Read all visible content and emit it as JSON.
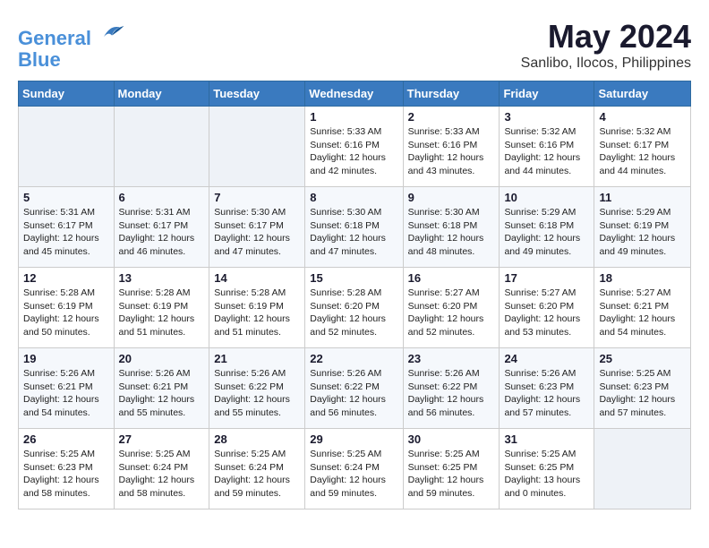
{
  "header": {
    "logo_line1": "General",
    "logo_line2": "Blue",
    "month": "May 2024",
    "location": "Sanlibo, Ilocos, Philippines"
  },
  "weekdays": [
    "Sunday",
    "Monday",
    "Tuesday",
    "Wednesday",
    "Thursday",
    "Friday",
    "Saturday"
  ],
  "weeks": [
    [
      {
        "day": "",
        "sunrise": "",
        "sunset": "",
        "daylight": ""
      },
      {
        "day": "",
        "sunrise": "",
        "sunset": "",
        "daylight": ""
      },
      {
        "day": "",
        "sunrise": "",
        "sunset": "",
        "daylight": ""
      },
      {
        "day": "1",
        "sunrise": "Sunrise: 5:33 AM",
        "sunset": "Sunset: 6:16 PM",
        "daylight": "Daylight: 12 hours and 42 minutes."
      },
      {
        "day": "2",
        "sunrise": "Sunrise: 5:33 AM",
        "sunset": "Sunset: 6:16 PM",
        "daylight": "Daylight: 12 hours and 43 minutes."
      },
      {
        "day": "3",
        "sunrise": "Sunrise: 5:32 AM",
        "sunset": "Sunset: 6:16 PM",
        "daylight": "Daylight: 12 hours and 44 minutes."
      },
      {
        "day": "4",
        "sunrise": "Sunrise: 5:32 AM",
        "sunset": "Sunset: 6:17 PM",
        "daylight": "Daylight: 12 hours and 44 minutes."
      }
    ],
    [
      {
        "day": "5",
        "sunrise": "Sunrise: 5:31 AM",
        "sunset": "Sunset: 6:17 PM",
        "daylight": "Daylight: 12 hours and 45 minutes."
      },
      {
        "day": "6",
        "sunrise": "Sunrise: 5:31 AM",
        "sunset": "Sunset: 6:17 PM",
        "daylight": "Daylight: 12 hours and 46 minutes."
      },
      {
        "day": "7",
        "sunrise": "Sunrise: 5:30 AM",
        "sunset": "Sunset: 6:17 PM",
        "daylight": "Daylight: 12 hours and 47 minutes."
      },
      {
        "day": "8",
        "sunrise": "Sunrise: 5:30 AM",
        "sunset": "Sunset: 6:18 PM",
        "daylight": "Daylight: 12 hours and 47 minutes."
      },
      {
        "day": "9",
        "sunrise": "Sunrise: 5:30 AM",
        "sunset": "Sunset: 6:18 PM",
        "daylight": "Daylight: 12 hours and 48 minutes."
      },
      {
        "day": "10",
        "sunrise": "Sunrise: 5:29 AM",
        "sunset": "Sunset: 6:18 PM",
        "daylight": "Daylight: 12 hours and 49 minutes."
      },
      {
        "day": "11",
        "sunrise": "Sunrise: 5:29 AM",
        "sunset": "Sunset: 6:19 PM",
        "daylight": "Daylight: 12 hours and 49 minutes."
      }
    ],
    [
      {
        "day": "12",
        "sunrise": "Sunrise: 5:28 AM",
        "sunset": "Sunset: 6:19 PM",
        "daylight": "Daylight: 12 hours and 50 minutes."
      },
      {
        "day": "13",
        "sunrise": "Sunrise: 5:28 AM",
        "sunset": "Sunset: 6:19 PM",
        "daylight": "Daylight: 12 hours and 51 minutes."
      },
      {
        "day": "14",
        "sunrise": "Sunrise: 5:28 AM",
        "sunset": "Sunset: 6:19 PM",
        "daylight": "Daylight: 12 hours and 51 minutes."
      },
      {
        "day": "15",
        "sunrise": "Sunrise: 5:28 AM",
        "sunset": "Sunset: 6:20 PM",
        "daylight": "Daylight: 12 hours and 52 minutes."
      },
      {
        "day": "16",
        "sunrise": "Sunrise: 5:27 AM",
        "sunset": "Sunset: 6:20 PM",
        "daylight": "Daylight: 12 hours and 52 minutes."
      },
      {
        "day": "17",
        "sunrise": "Sunrise: 5:27 AM",
        "sunset": "Sunset: 6:20 PM",
        "daylight": "Daylight: 12 hours and 53 minutes."
      },
      {
        "day": "18",
        "sunrise": "Sunrise: 5:27 AM",
        "sunset": "Sunset: 6:21 PM",
        "daylight": "Daylight: 12 hours and 54 minutes."
      }
    ],
    [
      {
        "day": "19",
        "sunrise": "Sunrise: 5:26 AM",
        "sunset": "Sunset: 6:21 PM",
        "daylight": "Daylight: 12 hours and 54 minutes."
      },
      {
        "day": "20",
        "sunrise": "Sunrise: 5:26 AM",
        "sunset": "Sunset: 6:21 PM",
        "daylight": "Daylight: 12 hours and 55 minutes."
      },
      {
        "day": "21",
        "sunrise": "Sunrise: 5:26 AM",
        "sunset": "Sunset: 6:22 PM",
        "daylight": "Daylight: 12 hours and 55 minutes."
      },
      {
        "day": "22",
        "sunrise": "Sunrise: 5:26 AM",
        "sunset": "Sunset: 6:22 PM",
        "daylight": "Daylight: 12 hours and 56 minutes."
      },
      {
        "day": "23",
        "sunrise": "Sunrise: 5:26 AM",
        "sunset": "Sunset: 6:22 PM",
        "daylight": "Daylight: 12 hours and 56 minutes."
      },
      {
        "day": "24",
        "sunrise": "Sunrise: 5:26 AM",
        "sunset": "Sunset: 6:23 PM",
        "daylight": "Daylight: 12 hours and 57 minutes."
      },
      {
        "day": "25",
        "sunrise": "Sunrise: 5:25 AM",
        "sunset": "Sunset: 6:23 PM",
        "daylight": "Daylight: 12 hours and 57 minutes."
      }
    ],
    [
      {
        "day": "26",
        "sunrise": "Sunrise: 5:25 AM",
        "sunset": "Sunset: 6:23 PM",
        "daylight": "Daylight: 12 hours and 58 minutes."
      },
      {
        "day": "27",
        "sunrise": "Sunrise: 5:25 AM",
        "sunset": "Sunset: 6:24 PM",
        "daylight": "Daylight: 12 hours and 58 minutes."
      },
      {
        "day": "28",
        "sunrise": "Sunrise: 5:25 AM",
        "sunset": "Sunset: 6:24 PM",
        "daylight": "Daylight: 12 hours and 59 minutes."
      },
      {
        "day": "29",
        "sunrise": "Sunrise: 5:25 AM",
        "sunset": "Sunset: 6:24 PM",
        "daylight": "Daylight: 12 hours and 59 minutes."
      },
      {
        "day": "30",
        "sunrise": "Sunrise: 5:25 AM",
        "sunset": "Sunset: 6:25 PM",
        "daylight": "Daylight: 12 hours and 59 minutes."
      },
      {
        "day": "31",
        "sunrise": "Sunrise: 5:25 AM",
        "sunset": "Sunset: 6:25 PM",
        "daylight": "Daylight: 13 hours and 0 minutes."
      },
      {
        "day": "",
        "sunrise": "",
        "sunset": "",
        "daylight": ""
      }
    ]
  ]
}
